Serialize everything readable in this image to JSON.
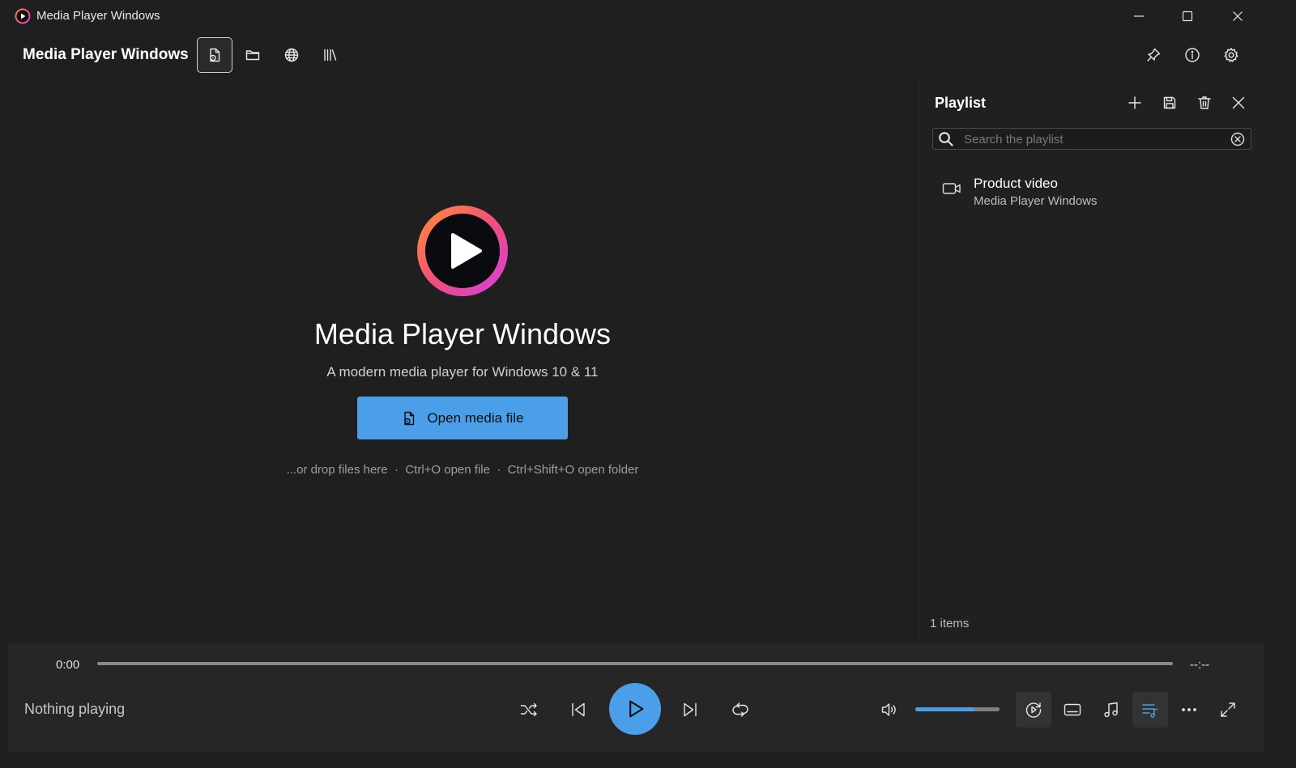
{
  "window": {
    "title": "Media Player Windows"
  },
  "header": {
    "title": "Media Player Windows",
    "tools": [
      "open-file-icon",
      "folder-icon",
      "globe-icon",
      "library-icon"
    ]
  },
  "welcome": {
    "title": "Media Player Windows",
    "subtitle": "A modern media player for Windows 10 & 11",
    "open_button": "Open media file",
    "hint_drop": "...or drop files here",
    "hint_open": "Ctrl+O open file",
    "hint_folder": "Ctrl+Shift+O open folder",
    "separator": "·"
  },
  "playlist": {
    "title": "Playlist",
    "search_placeholder": "Search the playlist",
    "items": [
      {
        "title": "Product video",
        "subtitle": "Media Player Windows",
        "icon": "video-icon"
      }
    ],
    "count_text": "1 items"
  },
  "player": {
    "current_time": "0:00",
    "total_time": "--:--",
    "now_playing": "Nothing playing",
    "volume_fraction": 0.7
  },
  "colors": {
    "accent": "#4a9fe8",
    "background": "#1f1f1f",
    "panel": "#202020",
    "controlbar": "#262626"
  }
}
